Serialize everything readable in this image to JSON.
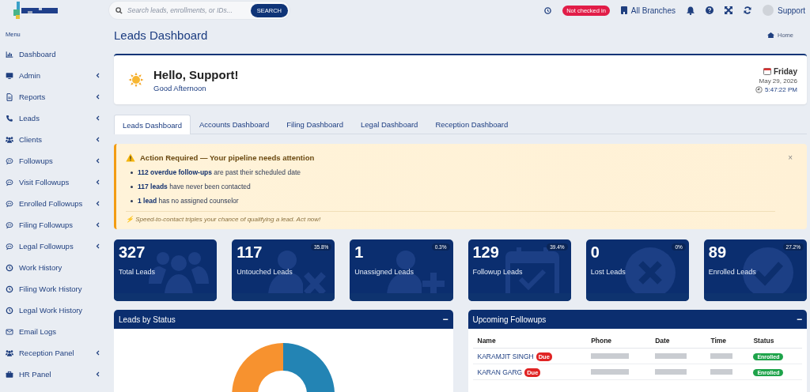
{
  "topbar": {
    "search": {
      "placeholder": "Search leads, enrollments, or IDs...",
      "button": "SEARCH"
    },
    "checkin_badge": "Not checked in",
    "branch": "All Branches",
    "user": "Support"
  },
  "sidebar": {
    "heading": "Menu",
    "items": [
      {
        "label": "Dashboard",
        "kind": "chart",
        "expandable": false
      },
      {
        "label": "Admin",
        "kind": "monitor",
        "expandable": true
      },
      {
        "label": "Reports",
        "kind": "file",
        "expandable": true
      },
      {
        "label": "Leads",
        "kind": "phone",
        "expandable": true
      },
      {
        "label": "Clients",
        "kind": "group",
        "expandable": true
      },
      {
        "label": "Followups",
        "kind": "chat",
        "expandable": true
      },
      {
        "label": "Visit Followups",
        "kind": "chat",
        "expandable": true
      },
      {
        "label": "Enrolled Followups",
        "kind": "chat",
        "expandable": true
      },
      {
        "label": "Filing Followups",
        "kind": "chat",
        "expandable": true
      },
      {
        "label": "Legal Followups",
        "kind": "chat",
        "expandable": true
      },
      {
        "label": "Work History",
        "kind": "clock",
        "expandable": false
      },
      {
        "label": "Filing Work History",
        "kind": "clock",
        "expandable": false
      },
      {
        "label": "Legal Work History",
        "kind": "clock",
        "expandable": false
      },
      {
        "label": "Email Logs",
        "kind": "mail",
        "expandable": false
      },
      {
        "label": "Reception Panel",
        "kind": "group",
        "expandable": true
      },
      {
        "label": "HR Panel",
        "kind": "briefcase",
        "expandable": true
      }
    ]
  },
  "page": {
    "title": "Leads Dashboard",
    "breadcrumb": "Home"
  },
  "greeting": {
    "title": "Hello, Support!",
    "subtitle": "Good Afternoon",
    "day": "Friday",
    "date": "May 29, 2026",
    "time": "5:47:22 PM"
  },
  "tabs": [
    {
      "label": "Leads Dashboard",
      "selected": true
    },
    {
      "label": "Accounts Dashboard",
      "selected": false
    },
    {
      "label": "Filing Dashboard",
      "selected": false
    },
    {
      "label": "Legal Dashboard",
      "selected": false
    },
    {
      "label": "Reception Dashboard",
      "selected": false
    }
  ],
  "alert": {
    "title": "Action Required — Your pipeline needs attention",
    "close": "×",
    "items": [
      "**112 overdue follow-ups** are past their scheduled date",
      "**117 leads** have never been contacted",
      "**1 lead** has no assigned counselor"
    ],
    "tip": "⚡ Speed-to-contact triples your chance of qualifying a lead. Act now!"
  },
  "stats": [
    {
      "value": "327",
      "label": "Total Leads",
      "kind": "total"
    },
    {
      "value": "117",
      "label": "Untouched Leads",
      "percent": "35.8%",
      "kind": "untouched"
    },
    {
      "value": "1",
      "label": "Unassigned Leads",
      "percent": "0.3%",
      "kind": "unassigned"
    },
    {
      "value": "129",
      "label": "Followup Leads",
      "percent": "39.4%",
      "kind": "followup"
    },
    {
      "value": "0",
      "label": "Lost Leads",
      "percent": "0%",
      "kind": "lost"
    },
    {
      "value": "89",
      "label": "Enrolled Leads",
      "percent": "27.2%",
      "kind": "enrolled"
    }
  ],
  "status_panel": {
    "title": "Leads by Status",
    "collapse": "−"
  },
  "followups_panel": {
    "title": "Upcoming Followups",
    "collapse": "−",
    "columns": [
      "Name",
      "Phone",
      "Date",
      "Time",
      "Status"
    ],
    "rows": [
      {
        "name": "KARAMJIT SINGH",
        "badge": "Due",
        "status": "Enrolled"
      },
      {
        "name": "KARAN GARG",
        "badge": "Due",
        "status": "Enrolled"
      }
    ]
  }
}
